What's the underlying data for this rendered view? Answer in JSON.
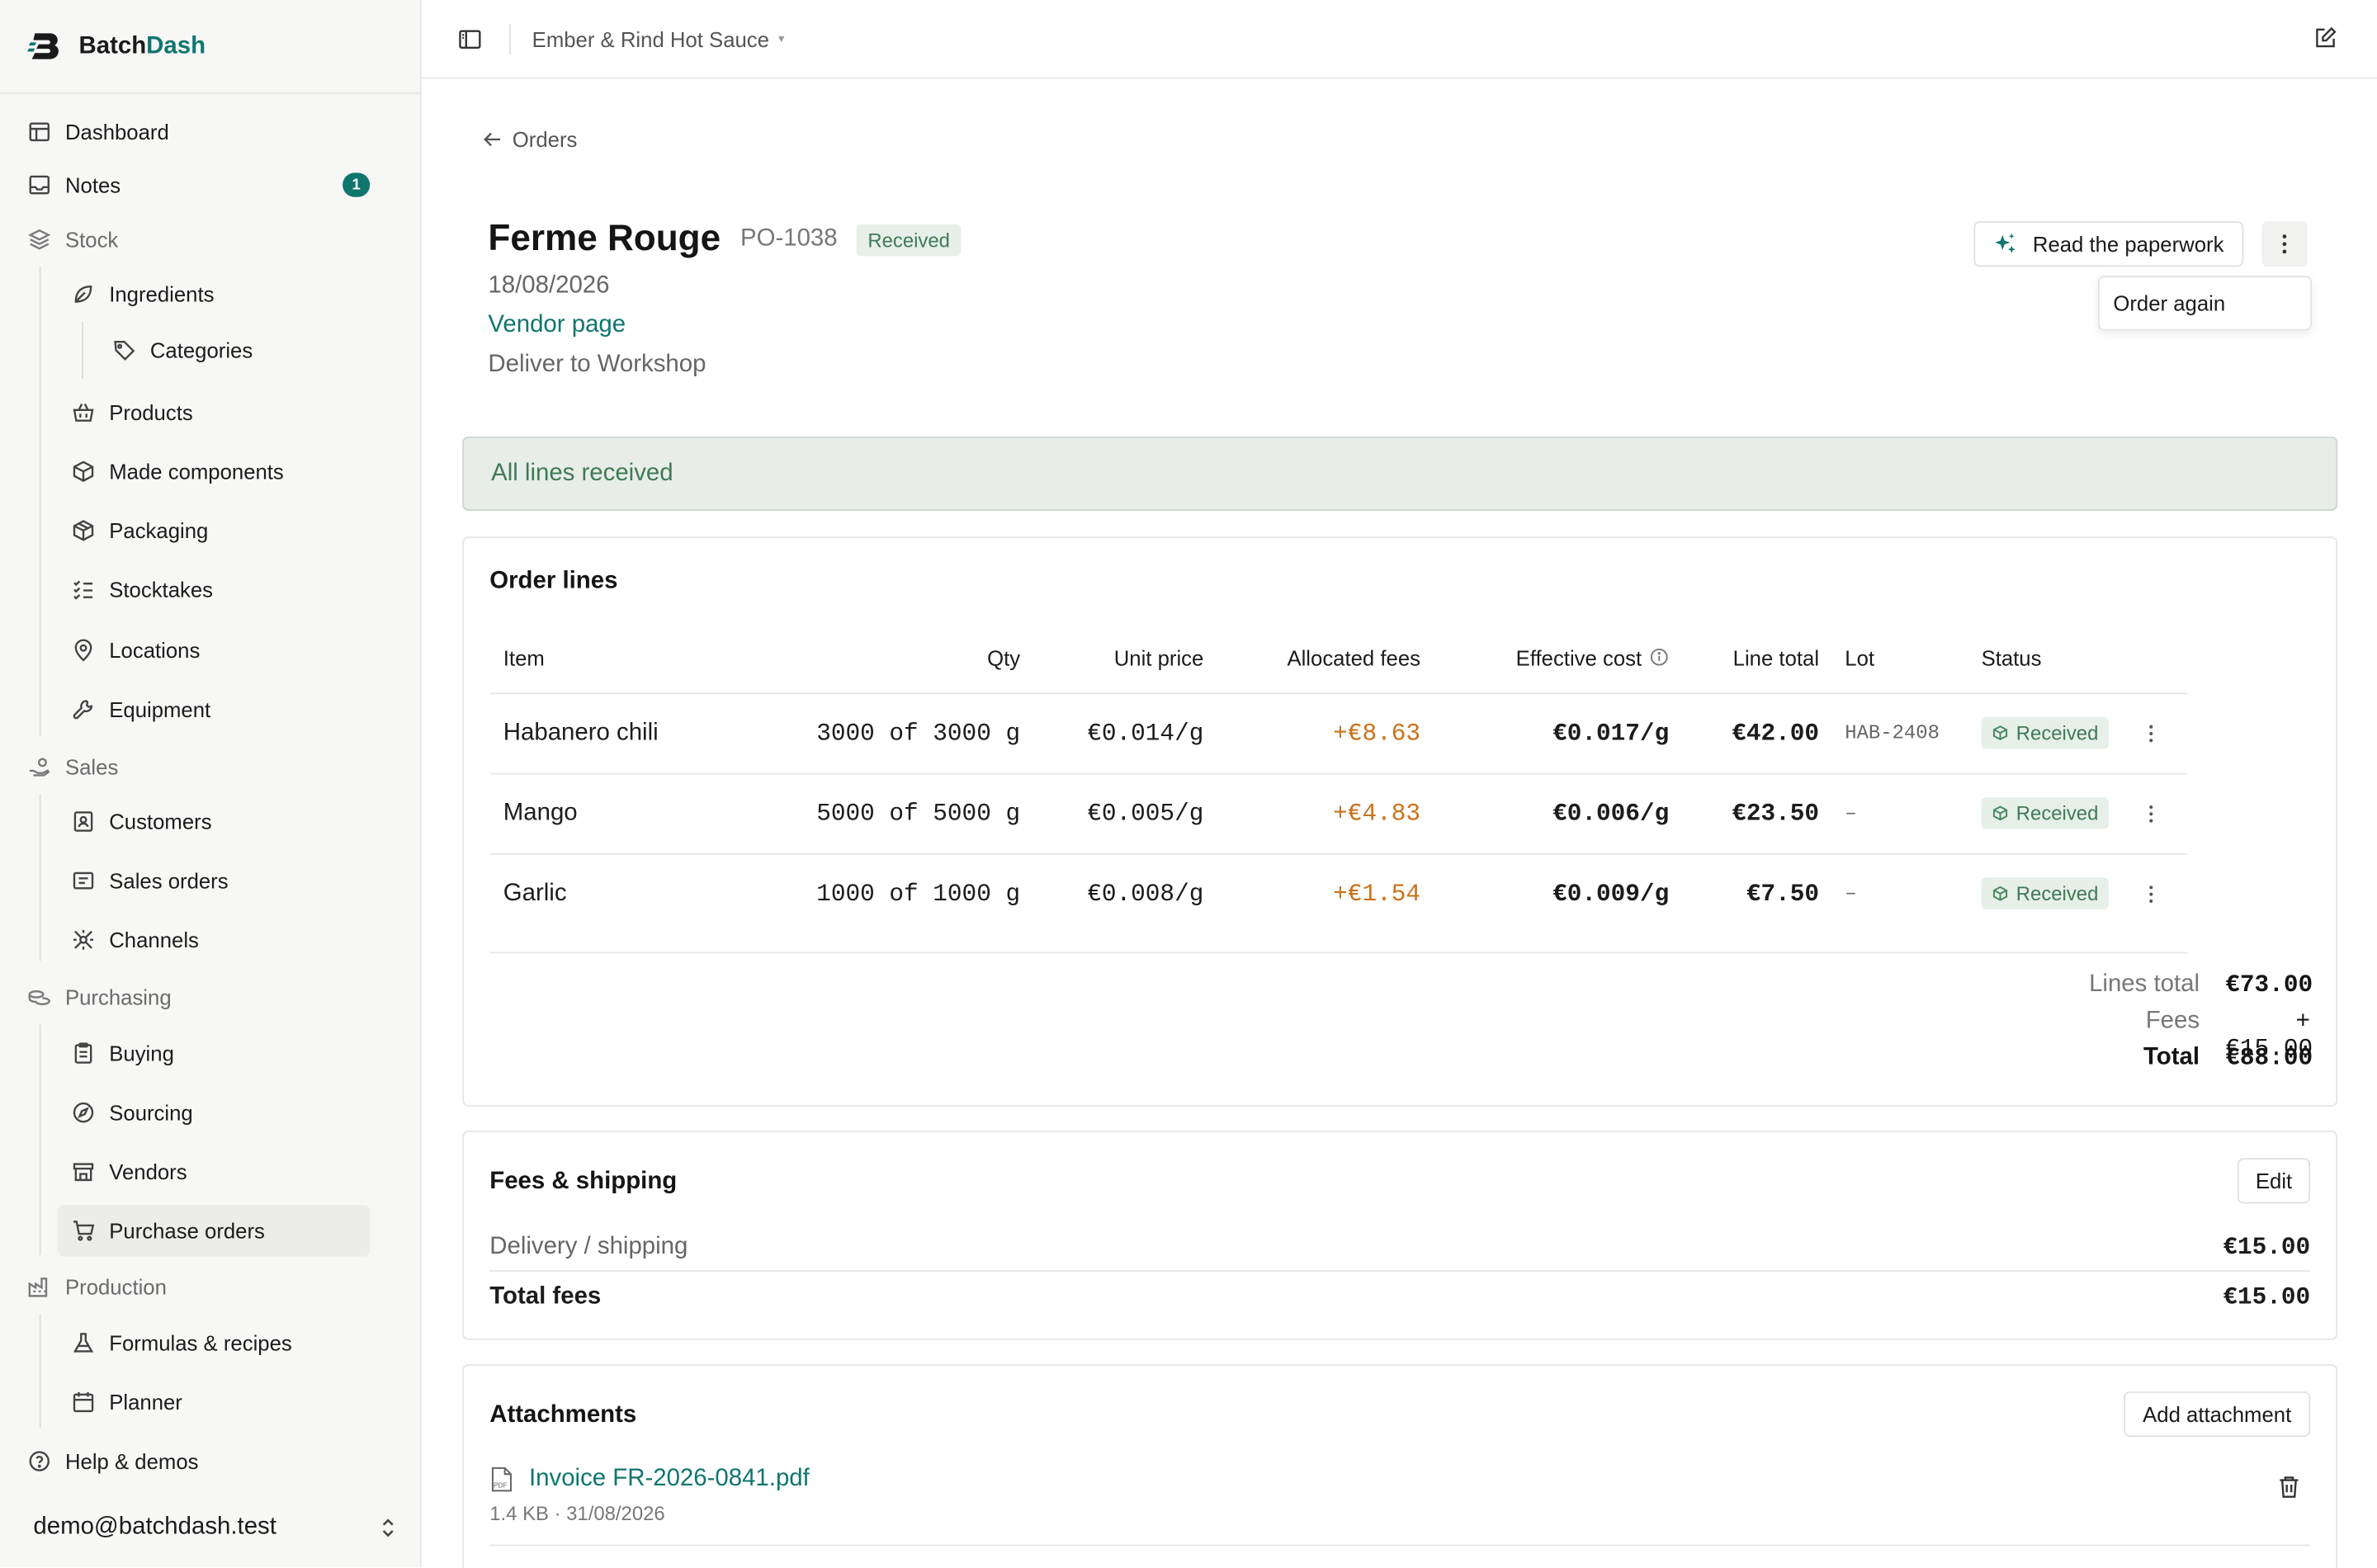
{
  "brand": {
    "name_part1": "Batch",
    "name_part2": "Dash"
  },
  "nav": {
    "dashboard": "Dashboard",
    "notes": "Notes",
    "notes_badge": "1",
    "stock": "Stock",
    "ingredients": "Ingredients",
    "categories": "Categories",
    "products": "Products",
    "made_components": "Made components",
    "packaging": "Packaging",
    "stocktakes": "Stocktakes",
    "locations": "Locations",
    "equipment": "Equipment",
    "sales": "Sales",
    "customers": "Customers",
    "sales_orders": "Sales orders",
    "channels": "Channels",
    "purchasing": "Purchasing",
    "buying": "Buying",
    "sourcing": "Sourcing",
    "vendors": "Vendors",
    "purchase_orders": "Purchase orders",
    "production": "Production",
    "formulas": "Formulas & recipes",
    "planner": "Planner",
    "help": "Help & demos"
  },
  "user": {
    "email": "demo@batchdash.test"
  },
  "topbar": {
    "workspace": "Ember & Rind Hot Sauce",
    "caret": "▾"
  },
  "page": {
    "back_label": "Orders",
    "vendor": "Ferme Rouge",
    "po_number": "PO-1038",
    "status": "Received",
    "date": "18/08/2026",
    "vendor_link": "Vendor page",
    "deliver_to": "Deliver to Workshop",
    "read_paperwork": "Read the paperwork",
    "menu_item": "Order again",
    "banner": "All lines received"
  },
  "order_lines": {
    "title": "Order lines",
    "columns": [
      "Item",
      "Qty",
      "Unit price",
      "Allocated fees",
      "Effective cost",
      "Line total",
      "Lot",
      "Status"
    ],
    "rows": [
      {
        "item": "Habanero chili",
        "qty": "3000 of 3000 g",
        "unit_price": "€0.014/g",
        "fees": "+€8.63",
        "effective": "€0.017/g",
        "total": "€42.00",
        "lot": "HAB-2408",
        "status": "Received"
      },
      {
        "item": "Mango",
        "qty": "5000 of 5000 g",
        "unit_price": "€0.005/g",
        "fees": "+€4.83",
        "effective": "€0.006/g",
        "total": "€23.50",
        "lot": "–",
        "status": "Received"
      },
      {
        "item": "Garlic",
        "qty": "1000 of 1000 g",
        "unit_price": "€0.008/g",
        "fees": "+€1.54",
        "effective": "€0.009/g",
        "total": "€7.50",
        "lot": "–",
        "status": "Received"
      }
    ],
    "lines_total_label": "Lines total",
    "lines_total": "€73.00",
    "fees_label": "Fees",
    "fees": "+€15.00",
    "total_label": "Total",
    "total": "€88.00"
  },
  "fees_shipping": {
    "title": "Fees & shipping",
    "edit": "Edit",
    "delivery_label": "Delivery / shipping",
    "delivery_value": "€15.00",
    "total_label": "Total fees",
    "total_value": "€15.00"
  },
  "attachments": {
    "title": "Attachments",
    "add": "Add attachment",
    "file_name": "Invoice FR-2026-0841.pdf",
    "file_meta": "1.4 KB · 31/08/2026",
    "pdf_tag": "PDF"
  },
  "colors": {
    "accent": "#0f766e",
    "fee": "#c9721a",
    "success_bg": "#e7efe9",
    "success_text": "#3f7a55"
  }
}
